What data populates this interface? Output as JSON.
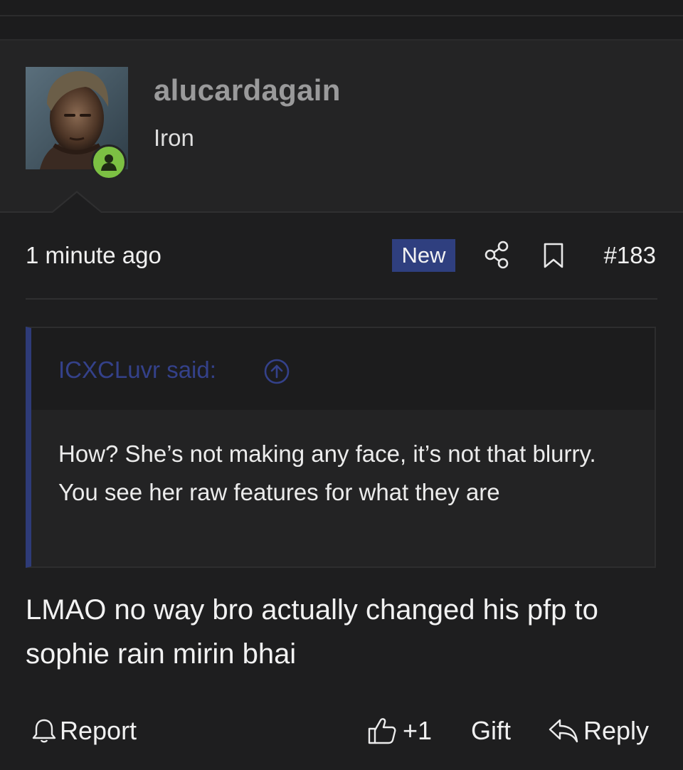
{
  "post": {
    "author": {
      "username": "alucardagain",
      "user_title": "Iron",
      "online_status": "online",
      "avatar_icon": "user-avatar-photo",
      "status_color": "#7cc043"
    },
    "time_ago": "1 minute ago",
    "badge": "New",
    "badge_color": "#2f3f7f",
    "post_number": "#183",
    "quote": {
      "author_line": "ICXCLuvr said:",
      "accent_color": "#2e3b78",
      "text": "How? She’s not making any face, it’s not that blurry. You see her raw features for what they are"
    },
    "message": "LMAO no way bro actually changed his pfp to sophie rain mirin bhai",
    "actions": {
      "report": "Report",
      "like": "+1",
      "gift": "Gift",
      "reply": "Reply"
    }
  }
}
